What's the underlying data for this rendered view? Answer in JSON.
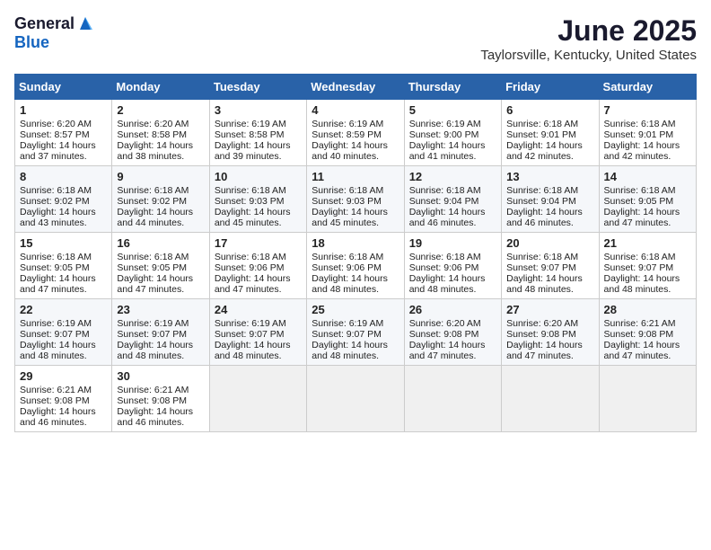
{
  "header": {
    "logo_general": "General",
    "logo_blue": "Blue",
    "month_title": "June 2025",
    "location": "Taylorsville, Kentucky, United States"
  },
  "days_of_week": [
    "Sunday",
    "Monday",
    "Tuesday",
    "Wednesday",
    "Thursday",
    "Friday",
    "Saturday"
  ],
  "weeks": [
    [
      {
        "day": "1",
        "sunrise": "Sunrise: 6:20 AM",
        "sunset": "Sunset: 8:57 PM",
        "daylight": "Daylight: 14 hours and 37 minutes."
      },
      {
        "day": "2",
        "sunrise": "Sunrise: 6:20 AM",
        "sunset": "Sunset: 8:58 PM",
        "daylight": "Daylight: 14 hours and 38 minutes."
      },
      {
        "day": "3",
        "sunrise": "Sunrise: 6:19 AM",
        "sunset": "Sunset: 8:58 PM",
        "daylight": "Daylight: 14 hours and 39 minutes."
      },
      {
        "day": "4",
        "sunrise": "Sunrise: 6:19 AM",
        "sunset": "Sunset: 8:59 PM",
        "daylight": "Daylight: 14 hours and 40 minutes."
      },
      {
        "day": "5",
        "sunrise": "Sunrise: 6:19 AM",
        "sunset": "Sunset: 9:00 PM",
        "daylight": "Daylight: 14 hours and 41 minutes."
      },
      {
        "day": "6",
        "sunrise": "Sunrise: 6:18 AM",
        "sunset": "Sunset: 9:01 PM",
        "daylight": "Daylight: 14 hours and 42 minutes."
      },
      {
        "day": "7",
        "sunrise": "Sunrise: 6:18 AM",
        "sunset": "Sunset: 9:01 PM",
        "daylight": "Daylight: 14 hours and 42 minutes."
      }
    ],
    [
      {
        "day": "8",
        "sunrise": "Sunrise: 6:18 AM",
        "sunset": "Sunset: 9:02 PM",
        "daylight": "Daylight: 14 hours and 43 minutes."
      },
      {
        "day": "9",
        "sunrise": "Sunrise: 6:18 AM",
        "sunset": "Sunset: 9:02 PM",
        "daylight": "Daylight: 14 hours and 44 minutes."
      },
      {
        "day": "10",
        "sunrise": "Sunrise: 6:18 AM",
        "sunset": "Sunset: 9:03 PM",
        "daylight": "Daylight: 14 hours and 45 minutes."
      },
      {
        "day": "11",
        "sunrise": "Sunrise: 6:18 AM",
        "sunset": "Sunset: 9:03 PM",
        "daylight": "Daylight: 14 hours and 45 minutes."
      },
      {
        "day": "12",
        "sunrise": "Sunrise: 6:18 AM",
        "sunset": "Sunset: 9:04 PM",
        "daylight": "Daylight: 14 hours and 46 minutes."
      },
      {
        "day": "13",
        "sunrise": "Sunrise: 6:18 AM",
        "sunset": "Sunset: 9:04 PM",
        "daylight": "Daylight: 14 hours and 46 minutes."
      },
      {
        "day": "14",
        "sunrise": "Sunrise: 6:18 AM",
        "sunset": "Sunset: 9:05 PM",
        "daylight": "Daylight: 14 hours and 47 minutes."
      }
    ],
    [
      {
        "day": "15",
        "sunrise": "Sunrise: 6:18 AM",
        "sunset": "Sunset: 9:05 PM",
        "daylight": "Daylight: 14 hours and 47 minutes."
      },
      {
        "day": "16",
        "sunrise": "Sunrise: 6:18 AM",
        "sunset": "Sunset: 9:05 PM",
        "daylight": "Daylight: 14 hours and 47 minutes."
      },
      {
        "day": "17",
        "sunrise": "Sunrise: 6:18 AM",
        "sunset": "Sunset: 9:06 PM",
        "daylight": "Daylight: 14 hours and 47 minutes."
      },
      {
        "day": "18",
        "sunrise": "Sunrise: 6:18 AM",
        "sunset": "Sunset: 9:06 PM",
        "daylight": "Daylight: 14 hours and 48 minutes."
      },
      {
        "day": "19",
        "sunrise": "Sunrise: 6:18 AM",
        "sunset": "Sunset: 9:06 PM",
        "daylight": "Daylight: 14 hours and 48 minutes."
      },
      {
        "day": "20",
        "sunrise": "Sunrise: 6:18 AM",
        "sunset": "Sunset: 9:07 PM",
        "daylight": "Daylight: 14 hours and 48 minutes."
      },
      {
        "day": "21",
        "sunrise": "Sunrise: 6:18 AM",
        "sunset": "Sunset: 9:07 PM",
        "daylight": "Daylight: 14 hours and 48 minutes."
      }
    ],
    [
      {
        "day": "22",
        "sunrise": "Sunrise: 6:19 AM",
        "sunset": "Sunset: 9:07 PM",
        "daylight": "Daylight: 14 hours and 48 minutes."
      },
      {
        "day": "23",
        "sunrise": "Sunrise: 6:19 AM",
        "sunset": "Sunset: 9:07 PM",
        "daylight": "Daylight: 14 hours and 48 minutes."
      },
      {
        "day": "24",
        "sunrise": "Sunrise: 6:19 AM",
        "sunset": "Sunset: 9:07 PM",
        "daylight": "Daylight: 14 hours and 48 minutes."
      },
      {
        "day": "25",
        "sunrise": "Sunrise: 6:19 AM",
        "sunset": "Sunset: 9:07 PM",
        "daylight": "Daylight: 14 hours and 48 minutes."
      },
      {
        "day": "26",
        "sunrise": "Sunrise: 6:20 AM",
        "sunset": "Sunset: 9:08 PM",
        "daylight": "Daylight: 14 hours and 47 minutes."
      },
      {
        "day": "27",
        "sunrise": "Sunrise: 6:20 AM",
        "sunset": "Sunset: 9:08 PM",
        "daylight": "Daylight: 14 hours and 47 minutes."
      },
      {
        "day": "28",
        "sunrise": "Sunrise: 6:21 AM",
        "sunset": "Sunset: 9:08 PM",
        "daylight": "Daylight: 14 hours and 47 minutes."
      }
    ],
    [
      {
        "day": "29",
        "sunrise": "Sunrise: 6:21 AM",
        "sunset": "Sunset: 9:08 PM",
        "daylight": "Daylight: 14 hours and 46 minutes."
      },
      {
        "day": "30",
        "sunrise": "Sunrise: 6:21 AM",
        "sunset": "Sunset: 9:08 PM",
        "daylight": "Daylight: 14 hours and 46 minutes."
      },
      null,
      null,
      null,
      null,
      null
    ]
  ]
}
